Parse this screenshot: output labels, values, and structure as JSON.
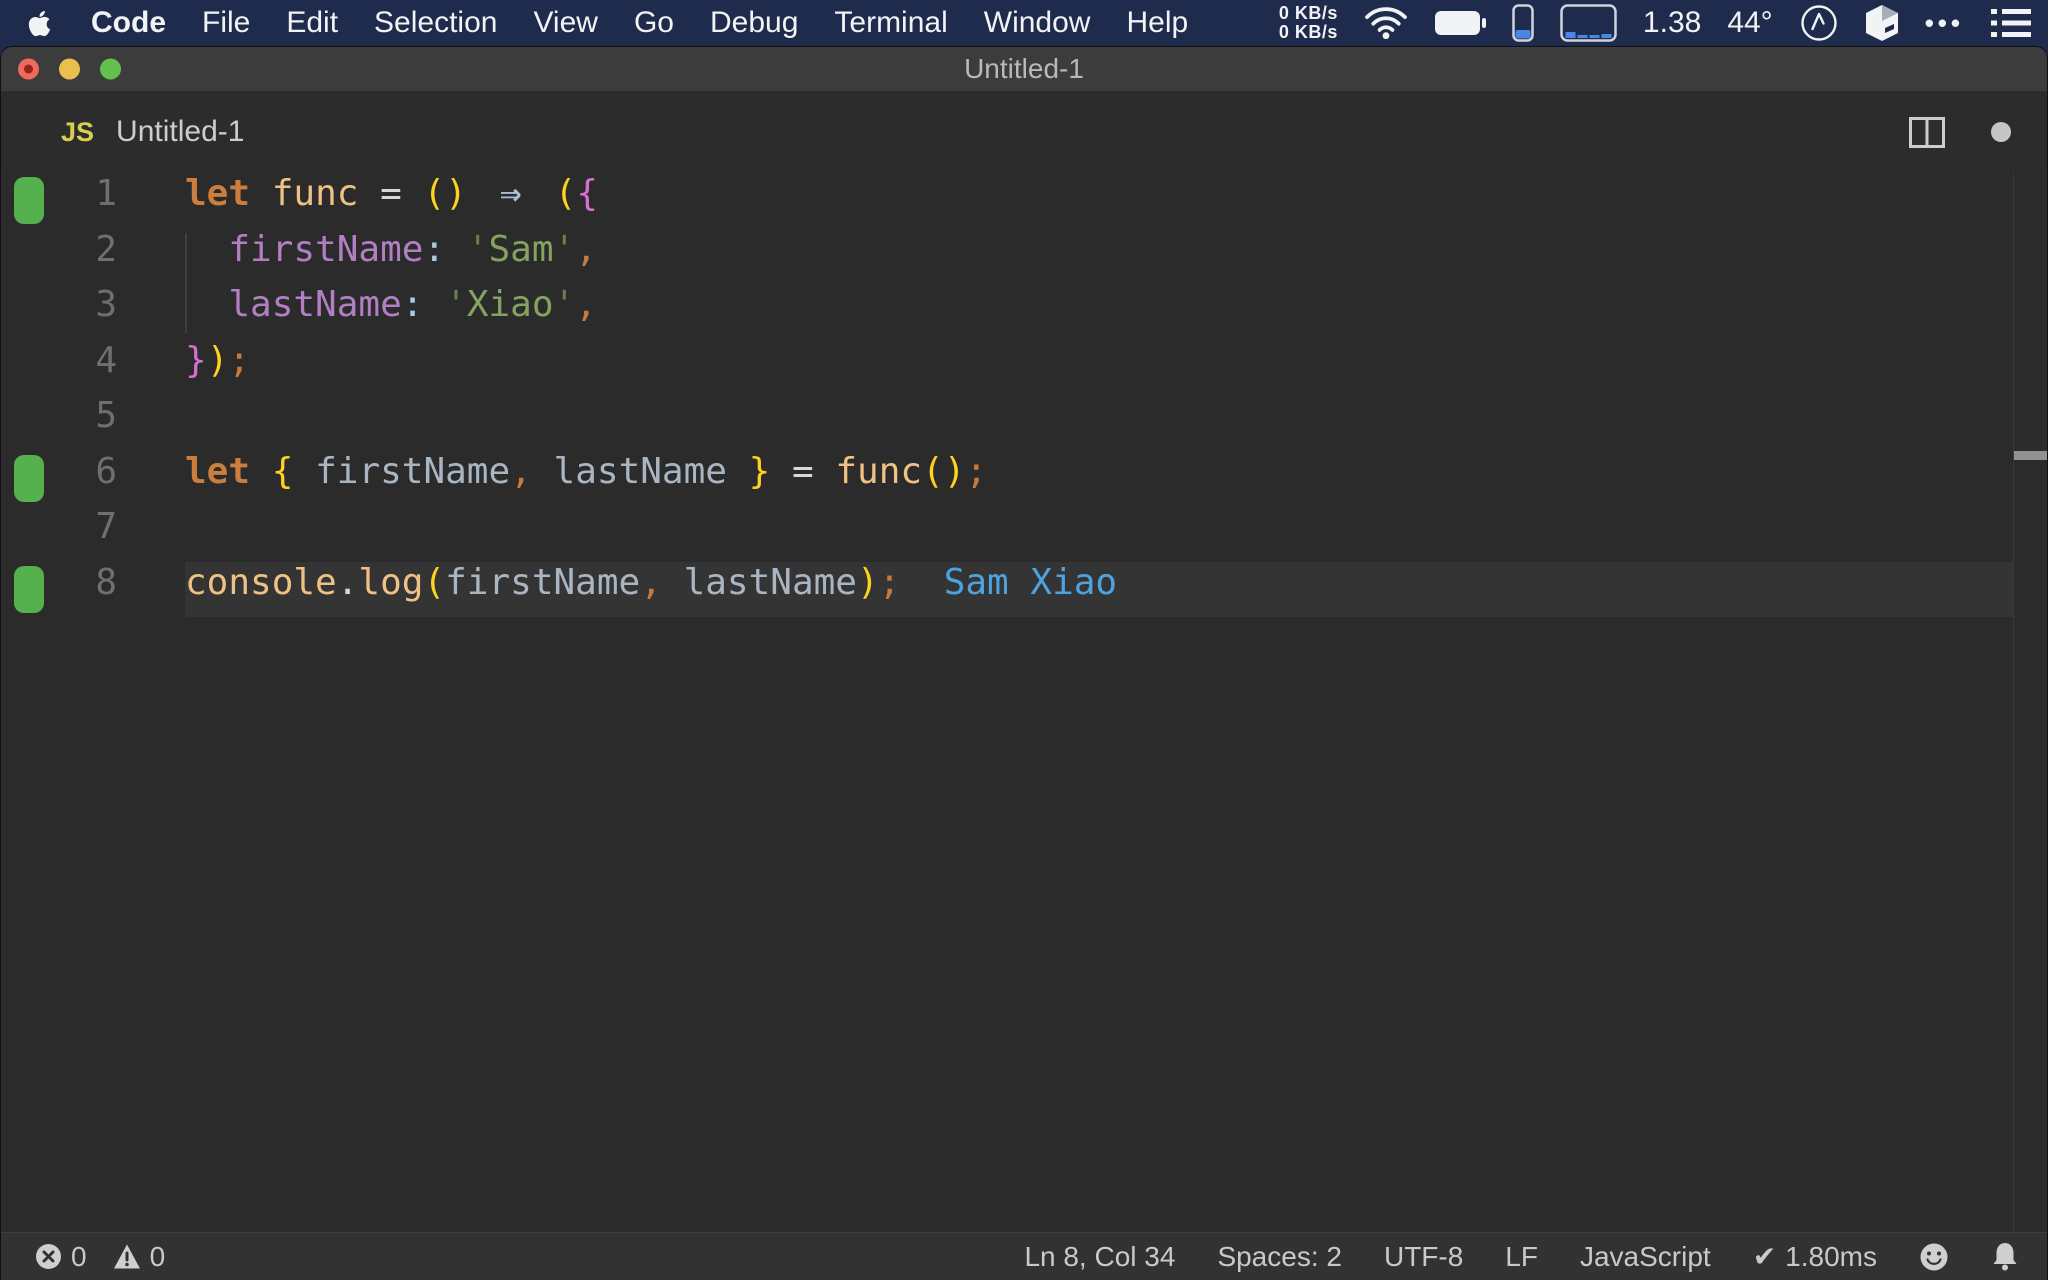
{
  "menu_bar": {
    "items": [
      "Code",
      "File",
      "Edit",
      "Selection",
      "View",
      "Go",
      "Debug",
      "Terminal",
      "Window",
      "Help"
    ],
    "net_up": "0 KB/s",
    "net_down": "0 KB/s",
    "load_average": "1.38",
    "temperature": "44°",
    "ellipsis": "•••",
    "icons": [
      "apple-logo",
      "wifi-icon",
      "battery-icon",
      "memory-gauge-icon",
      "cpu-history-icon",
      "compass-icon",
      "cube-icon",
      "ellipsis-icon",
      "list-menu-icon"
    ]
  },
  "window": {
    "title": "Untitled-1"
  },
  "tab": {
    "language_badge": "JS",
    "label": "Untitled-1",
    "icons": [
      "split-editor-icon",
      "unsaved-dot"
    ]
  },
  "editor": {
    "inline_output": "Sam Xiao",
    "lines": [
      {
        "num": "1",
        "marker": true,
        "tokens": [
          {
            "t": "let",
            "c": "kw"
          },
          {
            "t": " ",
            "c": "pl"
          },
          {
            "t": "func",
            "c": "fn"
          },
          {
            "t": " ",
            "c": "pl"
          },
          {
            "t": "=",
            "c": "op"
          },
          {
            "t": " ",
            "c": "pl"
          },
          {
            "t": "()",
            "c": "p1"
          },
          {
            "t": " ",
            "c": "pl"
          },
          {
            "t": "⇒",
            "c": "arrow"
          },
          {
            "t": " ",
            "c": "pl"
          },
          {
            "t": "(",
            "c": "p1"
          },
          {
            "t": "{",
            "c": "p2"
          }
        ]
      },
      {
        "num": "2",
        "tokens": [
          {
            "t": "  ",
            "c": "pl"
          },
          {
            "t": "firstName",
            "c": "prop"
          },
          {
            "t": ":",
            "c": "colon"
          },
          {
            "t": " ",
            "c": "pl"
          },
          {
            "t": "'",
            "c": "strq"
          },
          {
            "t": "Sam",
            "c": "str"
          },
          {
            "t": "'",
            "c": "strq"
          },
          {
            "t": ",",
            "c": "punc"
          }
        ]
      },
      {
        "num": "3",
        "tokens": [
          {
            "t": "  ",
            "c": "pl"
          },
          {
            "t": "lastName",
            "c": "prop"
          },
          {
            "t": ":",
            "c": "colon"
          },
          {
            "t": " ",
            "c": "pl"
          },
          {
            "t": "'",
            "c": "strq"
          },
          {
            "t": "Xiao",
            "c": "str"
          },
          {
            "t": "'",
            "c": "strq"
          },
          {
            "t": ",",
            "c": "punc"
          }
        ]
      },
      {
        "num": "4",
        "tokens": [
          {
            "t": "}",
            "c": "p2"
          },
          {
            "t": ")",
            "c": "p1"
          },
          {
            "t": ";",
            "c": "punc"
          }
        ]
      },
      {
        "num": "5",
        "tokens": []
      },
      {
        "num": "6",
        "marker": true,
        "tokens": [
          {
            "t": "let",
            "c": "kw"
          },
          {
            "t": " ",
            "c": "pl"
          },
          {
            "t": "{",
            "c": "p1"
          },
          {
            "t": " ",
            "c": "pl"
          },
          {
            "t": "firstName",
            "c": "var"
          },
          {
            "t": ",",
            "c": "punc"
          },
          {
            "t": " ",
            "c": "pl"
          },
          {
            "t": "lastName",
            "c": "var"
          },
          {
            "t": " ",
            "c": "pl"
          },
          {
            "t": "}",
            "c": "p1"
          },
          {
            "t": " ",
            "c": "pl"
          },
          {
            "t": "=",
            "c": "op"
          },
          {
            "t": " ",
            "c": "pl"
          },
          {
            "t": "func",
            "c": "fn"
          },
          {
            "t": "()",
            "c": "p1"
          },
          {
            "t": ";",
            "c": "punc"
          }
        ]
      },
      {
        "num": "7",
        "tokens": []
      },
      {
        "num": "8",
        "marker": true,
        "highlight": true,
        "tokens": [
          {
            "t": "console",
            "c": "fn"
          },
          {
            "t": ".",
            "c": "op"
          },
          {
            "t": "log",
            "c": "fn"
          },
          {
            "t": "(",
            "c": "p1"
          },
          {
            "t": "firstName",
            "c": "var"
          },
          {
            "t": ",",
            "c": "punc"
          },
          {
            "t": " ",
            "c": "pl"
          },
          {
            "t": "lastName",
            "c": "var"
          },
          {
            "t": ")",
            "c": "p1"
          },
          {
            "t": ";",
            "c": "punc"
          },
          {
            "t": "  ",
            "c": "pl"
          },
          {
            "t": "Sam Xiao",
            "c": "out"
          }
        ]
      }
    ]
  },
  "status_bar": {
    "errors": "0",
    "warnings": "0",
    "line_col": "Ln 8, Col 34",
    "indent": "Spaces: 2",
    "encoding": "UTF-8",
    "eol": "LF",
    "language": "JavaScript",
    "check": "✔",
    "exec_time": "1.80ms"
  },
  "colors": {
    "menu_bar_bg": "#1f2b4d",
    "title_bar_bg": "#3c3c3c",
    "editor_bg": "#2b2b2b",
    "status_bar_bg": "#323232",
    "keyword": "#cc7e3e",
    "function_name": "#efc184",
    "bracket_level1": "#ffd21c",
    "bracket_level2": "#d66fd0",
    "arrow": "#a9bdd3",
    "property": "#b27fc4",
    "string": "#84a35f",
    "punctuation": "#c87a3a",
    "variable": "#a9b6c2",
    "log_output_blue": "#4da2e0",
    "coverage_marker_green": "#54b14e",
    "traffic_red": "#ee6a5e",
    "traffic_yellow": "#e9c04d",
    "traffic_green": "#63c04f",
    "js_badge_yellow": "#d9cf4e",
    "gauge_blue": "#4a86e8"
  }
}
